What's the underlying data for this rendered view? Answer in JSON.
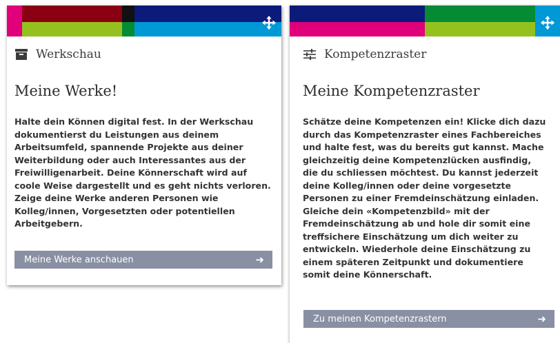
{
  "colors": {
    "magenta": "#e0007a",
    "maroon": "#8a0012",
    "lime": "#95c11f",
    "green": "#058b34",
    "navy": "#0c1a7a",
    "black": "#111111",
    "cyan": "#0099d6",
    "button": "#8a90a3"
  },
  "werkschau": {
    "header_icon": "archive-box-icon",
    "header_title": "Werkschau",
    "heading": "Meine Werke!",
    "body_lines": [
      "Halte dein Können digital fest. In der Werkschau",
      "dokumentierst du Leistungen aus deinem",
      "Arbeitsumfeld, spannende Projekte aus deiner",
      "Weiterbildung oder auch Interessantes aus der",
      "Freiwilligenarbeit. Deine Könnerschaft wird auf",
      "coole Weise dargestellt und es geht nichts verloren.",
      "Zeige deine Werke anderen Personen wie",
      "Kolleg/innen, Vorgesetzten oder potentiellen",
      "Arbeitgebern."
    ],
    "button_label": "Meine Werke anschauen",
    "button_icon": "arrow-right-icon",
    "move_icon": "move-arrows-icon"
  },
  "kompetenzraster": {
    "header_icon": "sliders-icon",
    "header_title": "Kompetenzraster",
    "heading": "Meine Kompetenzraster",
    "body_lines": [
      "Schätze deine Kompetenzen ein! Klicke dich dazu",
      "durch das Kompetenzraster eines Fachbereiches",
      "und halte fest, was du bereits gut kannst. Mache",
      "gleichzeitig deine Kompetenzlücken ausfindig,",
      "die du schliessen möchtest. Du kannst jederzeit",
      "deine Kolleg/innen oder deine vorgesetzte",
      "Personen zu einer Fremdeinschätzung einladen.",
      "Gleiche dein «Kompetenzbild» mit der",
      "Fremdeinschätzung ab und hole dir somit eine",
      "treffsichere Einschätzung um dich weiter zu",
      "entwickeln. Wiederhole deine Einschätzung zu",
      "einem späteren Zeitpunkt und dokumentiere",
      "somit deine Könnerschaft."
    ],
    "button_label": "Zu meinen Kompetenzrastern",
    "button_icon": "arrow-right-icon",
    "move_icon": "move-arrows-icon"
  }
}
